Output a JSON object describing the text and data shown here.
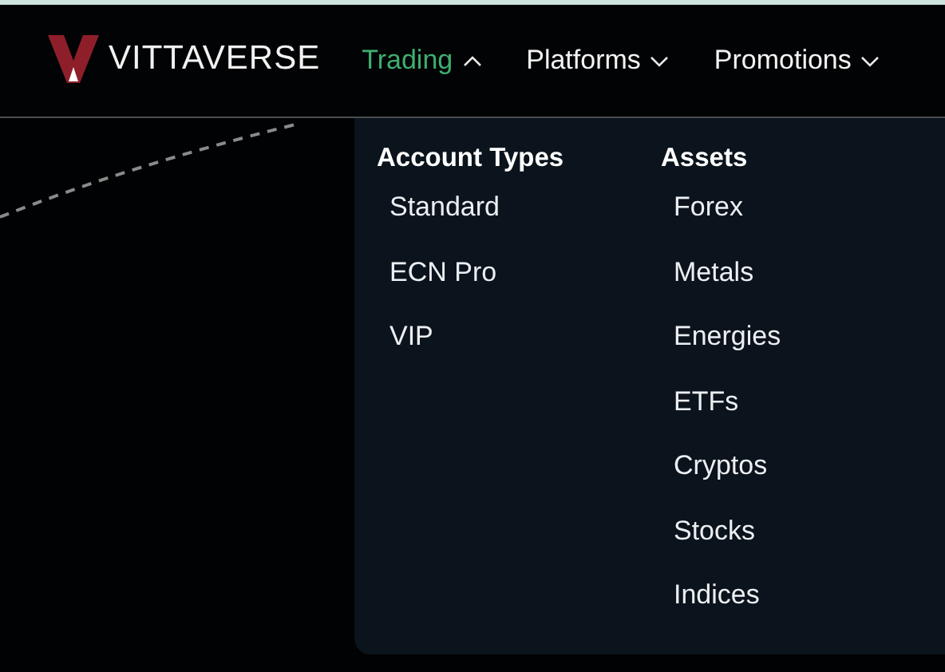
{
  "logo": {
    "text": "VITTAVERSE"
  },
  "nav": [
    {
      "label": "Trading",
      "selected": true,
      "expanded": true
    },
    {
      "label": "Platforms",
      "selected": false,
      "expanded": false
    },
    {
      "label": "Promotions",
      "selected": false,
      "expanded": false
    }
  ],
  "dropdown": {
    "columns": [
      {
        "heading": "Account Types",
        "items": [
          "Standard",
          "ECN Pro",
          "VIP"
        ]
      },
      {
        "heading": "Assets",
        "items": [
          "Forex",
          "Metals",
          "Energies",
          "ETFs",
          "Cryptos",
          "Stocks",
          "Indices"
        ]
      }
    ]
  }
}
